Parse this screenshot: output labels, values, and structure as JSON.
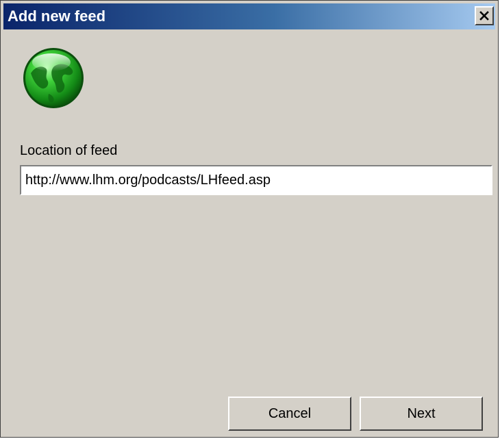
{
  "window": {
    "title": "Add new feed",
    "close_icon": "close-icon"
  },
  "header": {
    "icon": "globe-icon"
  },
  "form": {
    "feed_label": "Location of feed",
    "feed_value": "http://www.lhm.org/podcasts/LHfeed.asp"
  },
  "buttons": {
    "cancel_label": "Cancel",
    "next_label": "Next"
  },
  "colors": {
    "dialog_bg": "#d4d0c8",
    "title_start": "#0a246a",
    "title_end": "#a6caf0",
    "globe_green": "#2fbf2f"
  }
}
